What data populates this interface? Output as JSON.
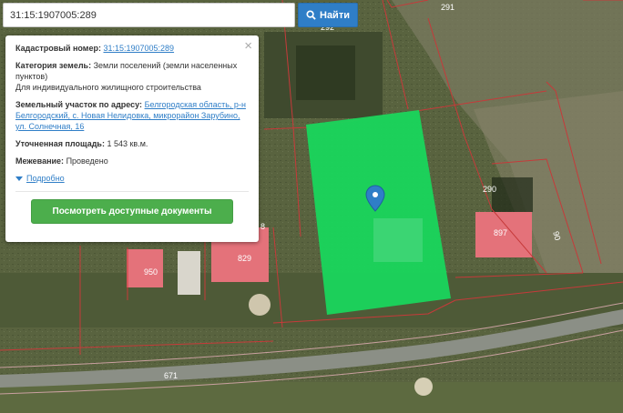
{
  "search": {
    "value": "31:15:1907005:289",
    "button_label": "Найти"
  },
  "popup": {
    "cadastral_label": "Кадастровый номер:",
    "cadastral_value": "31:15:1907005:289",
    "category_label": "Категория земель:",
    "category_value": "Земли поселений (земли населенных пунктов)",
    "usage": "Для индивидуального жилищного строительства",
    "address_label": "Земельный участок по адресу:",
    "address_value": "Белгородская область, р-н Белгородский, с. Новая Нелидовка, микрорайон Зарубино, ул. Солнечная, 16",
    "area_label": "Уточненная площадь:",
    "area_value": "1 543 кв.м.",
    "survey_label": "Межевание:",
    "survey_value": "Проведено",
    "more_label": "Подробно",
    "close_symbol": "×",
    "docs_button_label": "Посмотреть доступные документы"
  },
  "map": {
    "labels": {
      "l291": "291",
      "l292": "292",
      "l290": "290",
      "l897": "897",
      "l950": "950",
      "l829": "829",
      "l671": "671",
      "l90": "90",
      "l8": "8"
    },
    "colors": {
      "parcel_fill": "#19d65c",
      "boundary": "#c63a3a",
      "building": "#e4727a",
      "road": "#8b8f86"
    }
  }
}
